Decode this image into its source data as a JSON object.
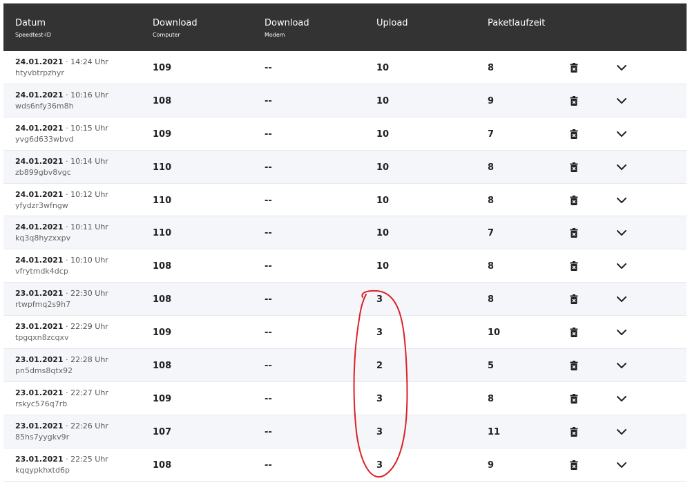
{
  "header": {
    "col_date": "Datum",
    "col_date_sub": "Speedtest-ID",
    "col_dl_computer": "Download",
    "col_dl_computer_sub": "Computer",
    "col_dl_modem": "Download",
    "col_dl_modem_sub": "Modem",
    "col_upload": "Upload",
    "col_latency": "Paketlaufzeit"
  },
  "rows": [
    {
      "date": "24.01.2021",
      "time": "· 14:24 Uhr",
      "id": "htyvbtrpzhyr",
      "dl_computer": "109",
      "dl_modem": "--",
      "upload": "10",
      "latency": "8"
    },
    {
      "date": "24.01.2021",
      "time": "· 10:16 Uhr",
      "id": "wds6nfy36m8h",
      "dl_computer": "108",
      "dl_modem": "--",
      "upload": "10",
      "latency": "9"
    },
    {
      "date": "24.01.2021",
      "time": "· 10:15 Uhr",
      "id": "yvg6d633wbvd",
      "dl_computer": "109",
      "dl_modem": "--",
      "upload": "10",
      "latency": "7"
    },
    {
      "date": "24.01.2021",
      "time": "· 10:14 Uhr",
      "id": "zb899gbv8vgc",
      "dl_computer": "110",
      "dl_modem": "--",
      "upload": "10",
      "latency": "8"
    },
    {
      "date": "24.01.2021",
      "time": "· 10:12 Uhr",
      "id": "yfydzr3wfngw",
      "dl_computer": "110",
      "dl_modem": "--",
      "upload": "10",
      "latency": "8"
    },
    {
      "date": "24.01.2021",
      "time": "· 10:11 Uhr",
      "id": "kq3q8hyzxxpv",
      "dl_computer": "110",
      "dl_modem": "--",
      "upload": "10",
      "latency": "7"
    },
    {
      "date": "24.01.2021",
      "time": "· 10:10 Uhr",
      "id": "vfrytmdk4dcp",
      "dl_computer": "108",
      "dl_modem": "--",
      "upload": "10",
      "latency": "8"
    },
    {
      "date": "23.01.2021",
      "time": "· 22:30 Uhr",
      "id": "rtwpfmq2s9h7",
      "dl_computer": "108",
      "dl_modem": "--",
      "upload": "3",
      "latency": "8"
    },
    {
      "date": "23.01.2021",
      "time": "· 22:29 Uhr",
      "id": "tpgqxn8zcqxv",
      "dl_computer": "109",
      "dl_modem": "--",
      "upload": "3",
      "latency": "10"
    },
    {
      "date": "23.01.2021",
      "time": "· 22:28 Uhr",
      "id": "pn5dms8qtx92",
      "dl_computer": "108",
      "dl_modem": "--",
      "upload": "2",
      "latency": "5"
    },
    {
      "date": "23.01.2021",
      "time": "· 22:27 Uhr",
      "id": "rskyc576q7rb",
      "dl_computer": "109",
      "dl_modem": "--",
      "upload": "3",
      "latency": "8"
    },
    {
      "date": "23.01.2021",
      "time": "· 22:26 Uhr",
      "id": "85hs7yygkv9r",
      "dl_computer": "107",
      "dl_modem": "--",
      "upload": "3",
      "latency": "11"
    },
    {
      "date": "23.01.2021",
      "time": "· 22:25 Uhr",
      "id": "kqqypkhxtd6p",
      "dl_computer": "108",
      "dl_modem": "--",
      "upload": "3",
      "latency": "9"
    }
  ],
  "icons": {
    "delete": "trash-icon",
    "expand": "chevron-down-icon"
  },
  "colors": {
    "header_bg": "#333333",
    "alt_row": "#f4f6f9",
    "annotation": "#dd1f26"
  }
}
